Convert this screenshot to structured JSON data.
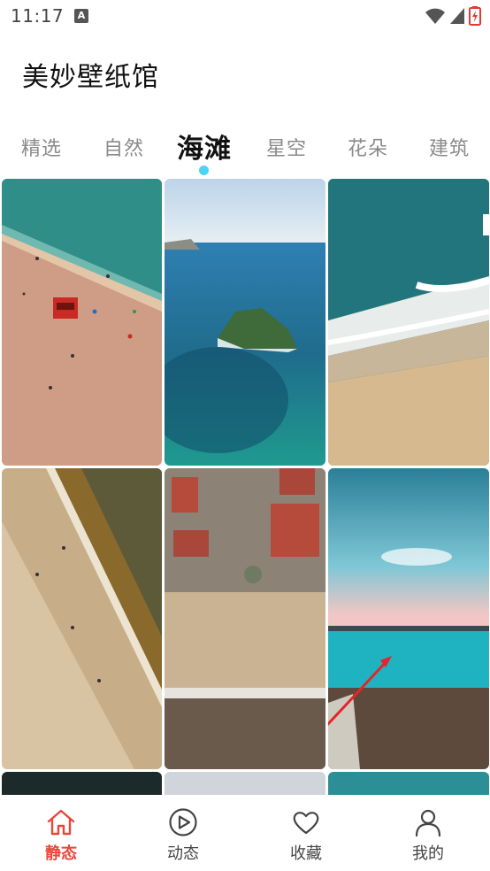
{
  "status_bar": {
    "time": "11:17",
    "notification_icon": "a-letter-icon",
    "icons": [
      "wifi-icon",
      "cellular-signal-icon",
      "battery-charging-icon"
    ],
    "battery_color": "#e03b2f"
  },
  "app": {
    "title": "美妙壁纸馆"
  },
  "tabs": {
    "items": [
      {
        "label": "精选"
      },
      {
        "label": "自然"
      },
      {
        "label": "海滩"
      },
      {
        "label": "星空"
      },
      {
        "label": "花朵"
      },
      {
        "label": "建筑"
      }
    ],
    "active": "海滩",
    "indicator_color": "#4fd3f2"
  },
  "wallpapers": {
    "images": [
      {
        "subject": "aerial beach with red lifeguard tower"
      },
      {
        "subject": "sea island under blue sky"
      },
      {
        "subject": "aerial waves breaking on sand"
      },
      {
        "subject": "golden shoreline with crowd"
      },
      {
        "subject": "aerial coastal town and beach"
      },
      {
        "subject": "turquoise sea under cloudy sky"
      },
      {
        "subject": "dark wallpaper (partially visible)"
      },
      {
        "subject": "light wallpaper (partially visible)"
      },
      {
        "subject": "teal water (partially visible)"
      }
    ]
  },
  "bottom_nav": {
    "items": [
      {
        "label": "静态",
        "icon": "home-icon"
      },
      {
        "label": "动态",
        "icon": "play-circle-icon"
      },
      {
        "label": "收藏",
        "icon": "heart-icon"
      },
      {
        "label": "我的",
        "icon": "user-icon"
      }
    ],
    "active": "静态",
    "active_color": "#e8473a",
    "inactive_color": "#444444"
  }
}
